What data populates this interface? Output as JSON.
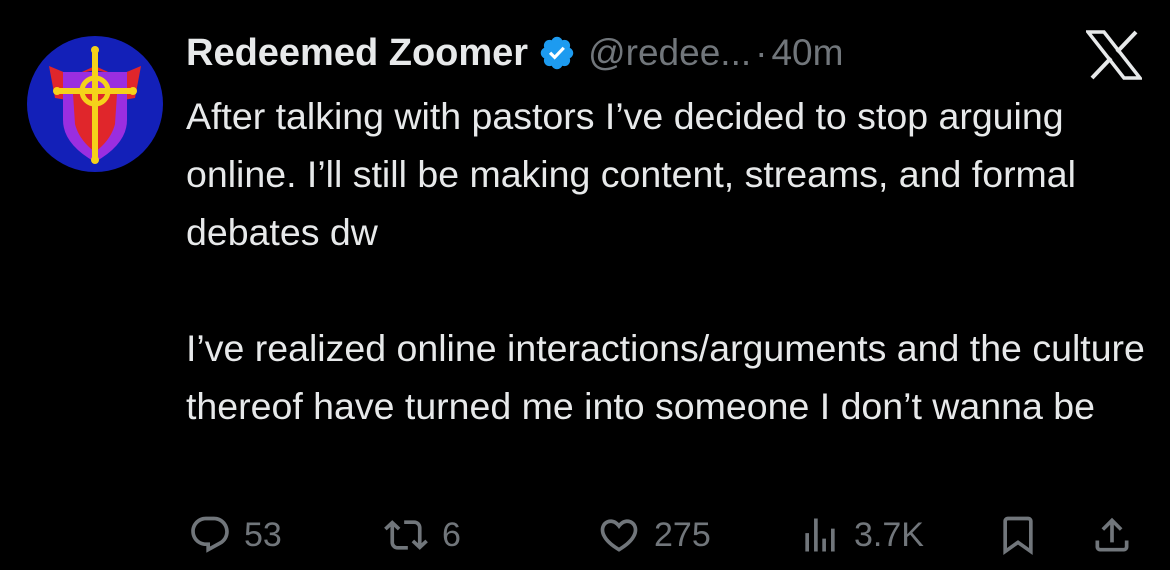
{
  "tweet": {
    "display_name": "Redeemed Zoomer",
    "handle": "@redee...",
    "separator": "·",
    "time": "40m",
    "body": "After talking with pastors I’ve decided to stop arguing online. I’ll still be making content, streams, and formal debates dw\n\nI’ve realized online interactions/arguments and the culture thereof have turned me into someone I don’t wanna be",
    "icons": {
      "avatar": "shield-cross-avatar",
      "verified": "verified-badge-icon",
      "platform": "x-logo-icon"
    }
  },
  "actions": {
    "replies": "53",
    "retweets": "6",
    "likes": "275",
    "views": "3.7K"
  },
  "colors": {
    "background": "#000000",
    "text": "#e7e9ea",
    "muted": "#71767b",
    "verified": "#1d9bf0"
  }
}
